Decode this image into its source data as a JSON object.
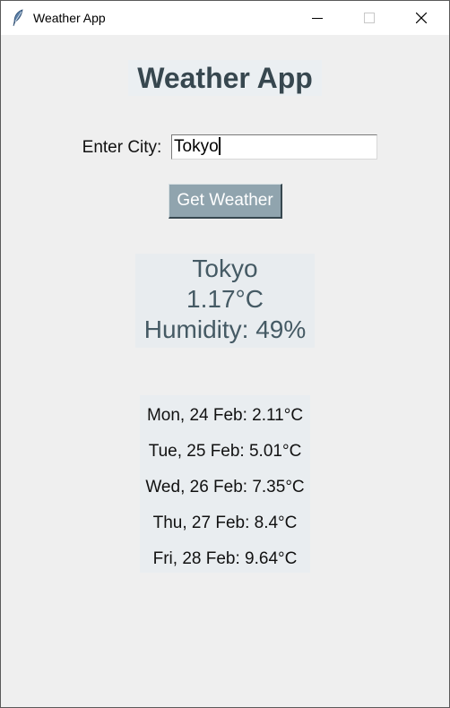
{
  "window": {
    "title": "Weather App"
  },
  "app": {
    "heading": "Weather App",
    "city_label": "Enter City:",
    "city_value": "Tokyo",
    "button_label": "Get Weather"
  },
  "current": {
    "city": "Tokyo",
    "temperature": "1.17°C",
    "humidity": "Humidity: 49%"
  },
  "forecast": [
    "Mon, 24 Feb: 2.11°C",
    "Tue, 25 Feb: 5.01°C",
    "Wed, 26 Feb: 7.35°C",
    "Thu, 27 Feb: 8.4°C",
    "Fri, 28 Feb: 9.64°C"
  ],
  "colors": {
    "heading_text": "#37474f",
    "button_bg": "#90a4ae",
    "result_text": "#455a64",
    "window_bg": "#efefef"
  },
  "icons": {
    "app_icon": "feather-icon",
    "minimize": "minimize-icon",
    "maximize": "maximize-icon",
    "close": "close-icon"
  }
}
